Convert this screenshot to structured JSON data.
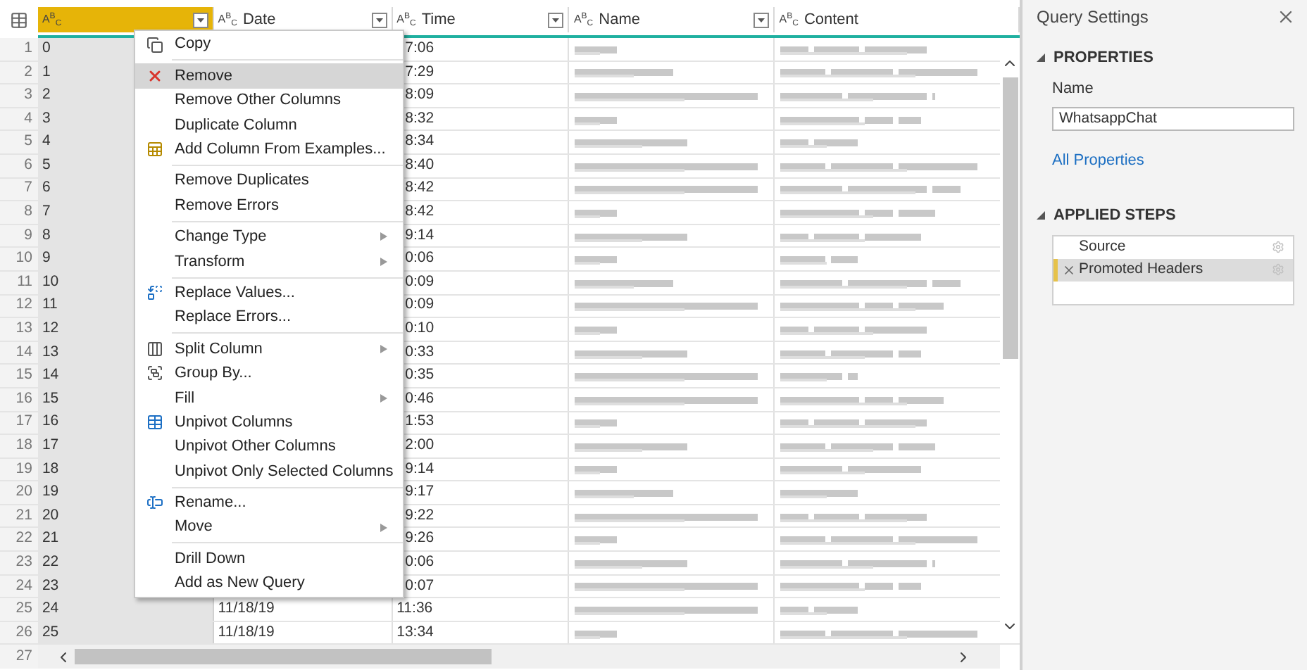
{
  "columns": [
    {
      "type": "A$^{B}$$_{C}$",
      "selected": true
    },
    {
      "type": "A$^{B}$$_{C}$",
      "label": "Date",
      "selected": false
    },
    {
      "type": "A$^{B}$$_{C}$",
      "label": "Time",
      "selected": false
    },
    {
      "type": "A$^{B}$$_{C}$",
      "label": "Name",
      "selected": false
    },
    {
      "type": "A$^{B}$$_{C}$",
      "label": "Content",
      "selected": false
    }
  ],
  "rows": [
    {
      "num": "1",
      "index": "0",
      "time": "7:06"
    },
    {
      "num": "2",
      "index": "1",
      "time": "7:29"
    },
    {
      "num": "3",
      "index": "2",
      "time": "8:09"
    },
    {
      "num": "4",
      "index": "3",
      "time": "8:32"
    },
    {
      "num": "5",
      "index": "4",
      "time": "8:34"
    },
    {
      "num": "6",
      "index": "5",
      "time": "8:40"
    },
    {
      "num": "7",
      "index": "6",
      "time": "8:42"
    },
    {
      "num": "8",
      "index": "7",
      "time": "8:42"
    },
    {
      "num": "9",
      "index": "8",
      "time": "9:14"
    },
    {
      "num": "10",
      "index": "9",
      "time": "0:06"
    },
    {
      "num": "11",
      "index": "10",
      "time": "0:09"
    },
    {
      "num": "12",
      "index": "11",
      "time": "0:09"
    },
    {
      "num": "13",
      "index": "12",
      "time": "0:10"
    },
    {
      "num": "14",
      "index": "13",
      "time": "0:33"
    },
    {
      "num": "15",
      "index": "14",
      "time": "0:35"
    },
    {
      "num": "16",
      "index": "15",
      "time": "0:46"
    },
    {
      "num": "17",
      "index": "16",
      "time": "1:53"
    },
    {
      "num": "18",
      "index": "17",
      "time": "2:00"
    },
    {
      "num": "19",
      "index": "18",
      "time": "9:14"
    },
    {
      "num": "20",
      "index": "19",
      "time": "9:17"
    },
    {
      "num": "21",
      "index": "20",
      "time": "9:22"
    },
    {
      "num": "22",
      "index": "21",
      "time": "9:26"
    },
    {
      "num": "23",
      "index": "22",
      "time": "0:06"
    },
    {
      "num": "24",
      "index": "23",
      "time": "0:07"
    },
    {
      "num": "25",
      "index": "24",
      "date": "11/18/19",
      "time": "11:36"
    },
    {
      "num": "26",
      "index": "25",
      "date": "11/18/19",
      "time": "13:34"
    }
  ],
  "last_row": {
    "num": "27"
  },
  "context_menu": {
    "groups": [
      [
        {
          "label": "Copy",
          "submenu": false,
          "selected": false
        }
      ],
      [
        {
          "label": "Remove",
          "submenu": false,
          "selected": true
        },
        {
          "label": "Remove Other Columns",
          "submenu": false,
          "selected": false
        },
        {
          "label": "Duplicate Column",
          "submenu": false,
          "selected": false
        },
        {
          "label": "Add Column From Examples...",
          "submenu": false,
          "selected": false
        }
      ],
      [
        {
          "label": "Remove Duplicates",
          "submenu": false,
          "selected": false
        },
        {
          "label": "Remove Errors",
          "submenu": false,
          "selected": false
        }
      ],
      [
        {
          "label": "Change Type",
          "submenu": true,
          "selected": false
        },
        {
          "label": "Transform",
          "submenu": true,
          "selected": false
        }
      ],
      [
        {
          "label": "Replace Values...",
          "submenu": false,
          "selected": false
        },
        {
          "label": "Replace Errors...",
          "submenu": false,
          "selected": false
        }
      ],
      [
        {
          "label": "Split Column",
          "submenu": true,
          "selected": false
        },
        {
          "label": "Group By...",
          "submenu": false,
          "selected": false
        },
        {
          "label": "Fill",
          "submenu": true,
          "selected": false
        },
        {
          "label": "Unpivot Columns",
          "submenu": false,
          "selected": false
        },
        {
          "label": "Unpivot Other Columns",
          "submenu": false,
          "selected": false
        },
        {
          "label": "Unpivot Only Selected Columns",
          "submenu": false,
          "selected": false
        }
      ],
      [
        {
          "label": "Rename...",
          "submenu": false,
          "selected": false
        },
        {
          "label": "Move",
          "submenu": true,
          "selected": false
        }
      ],
      [
        {
          "label": "Drill Down",
          "submenu": false,
          "selected": false
        },
        {
          "label": "Add as New Query",
          "submenu": false,
          "selected": false
        }
      ]
    ]
  },
  "query_settings": {
    "title": "Query Settings",
    "properties": {
      "heading": "PROPERTIES",
      "expanded": true,
      "name_label": "Name",
      "name_value": "WhatsappChat",
      "link": "All Properties"
    },
    "applied_steps": {
      "heading": "APPLIED STEPS",
      "expanded": true,
      "steps": [
        {
          "label": "Source",
          "selected": false
        },
        {
          "label": "Promoted Headers",
          "selected": true
        }
      ]
    }
  }
}
